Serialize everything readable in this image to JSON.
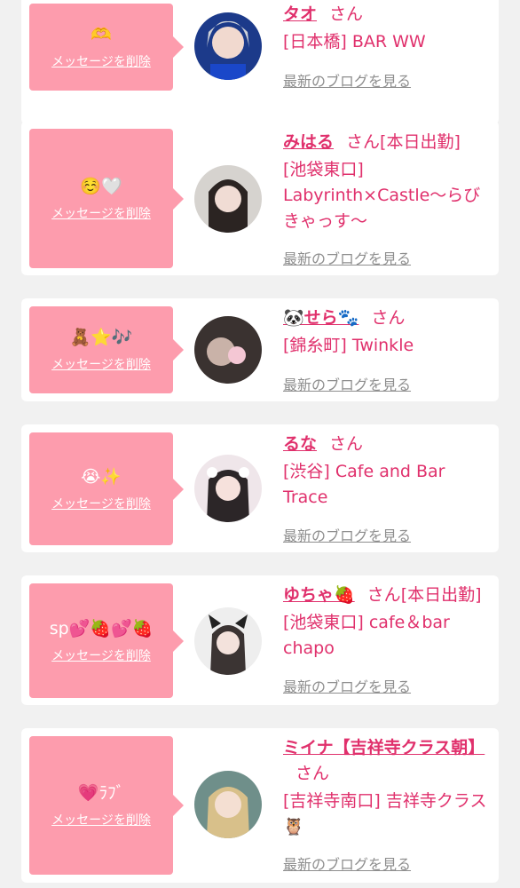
{
  "delete_label": "メッセージを削除",
  "blog_label": "最新のブログを見る",
  "san_label": "さん",
  "colors": {
    "accent": "#e0306c",
    "bubble": "#fd9cad",
    "link_gray": "#8e8e8e",
    "background": "#f1f1f1"
  },
  "cards": [
    {
      "message": "🫶",
      "name": "タオ",
      "status": "",
      "shop": "[日本橋] BAR WW"
    },
    {
      "message": "☺️🤍",
      "name": "みはる",
      "status": "[本日出勤]",
      "shop": "[池袋東口] Labyrinth×Castle〜らびきゃっす〜"
    },
    {
      "message": "🧸⭐️🎶",
      "name": "🐼せら🐾",
      "status": "",
      "shop": "[錦糸町] Twinkle"
    },
    {
      "message": "😭✨",
      "name": "るな",
      "status": "",
      "shop": "[渋谷] Cafe and Bar Trace"
    },
    {
      "message": "sp💕🍓💕🍓",
      "name": "ゆちゃ🍓",
      "status": "[本日出勤]",
      "shop": "[池袋東口] cafe＆bar chapo"
    },
    {
      "message": "💗ﾗﾌﾞ",
      "name": "ミイナ【吉祥寺クラス朝】",
      "status": "",
      "shop": "[吉祥寺南口] 吉祥寺クラス🦉"
    }
  ]
}
